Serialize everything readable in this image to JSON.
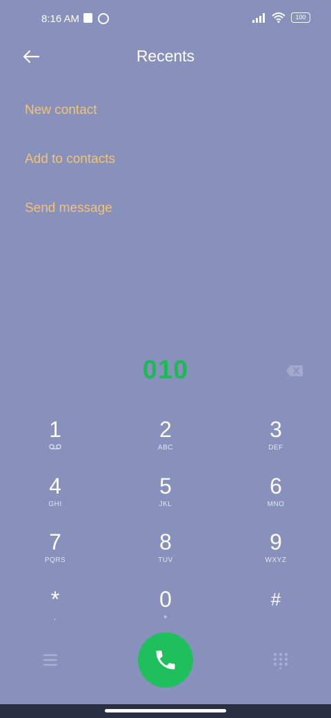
{
  "status_bar": {
    "time": "8:16 AM",
    "battery": "100",
    "icons": [
      "notification-square-icon",
      "app-ring-icon",
      "signal-icon",
      "wifi-icon",
      "battery-icon"
    ]
  },
  "header": {
    "title": "Recents",
    "back_icon": "arrow-left-icon"
  },
  "actions": [
    {
      "label": "New contact"
    },
    {
      "label": "Add to contacts"
    },
    {
      "label": "Send message"
    }
  ],
  "dialer": {
    "number": "010",
    "backspace_icon": "backspace-icon"
  },
  "keypad": [
    {
      "digit": "1",
      "sub": "",
      "sub_icon": "voicemail-icon"
    },
    {
      "digit": "2",
      "sub": "ABC"
    },
    {
      "digit": "3",
      "sub": "DEF"
    },
    {
      "digit": "4",
      "sub": "GHI"
    },
    {
      "digit": "5",
      "sub": "JKL"
    },
    {
      "digit": "6",
      "sub": "MNO"
    },
    {
      "digit": "7",
      "sub": "PQRS"
    },
    {
      "digit": "8",
      "sub": "TUV"
    },
    {
      "digit": "9",
      "sub": "WXYZ"
    },
    {
      "digit": "*",
      "sub": ","
    },
    {
      "digit": "0",
      "sub": "+"
    },
    {
      "digit": "#",
      "sub": ""
    }
  ],
  "bottom_bar": {
    "menu_icon": "hamburger-menu-icon",
    "call_icon": "phone-icon",
    "dialpad_icon": "dialpad-grid-icon"
  },
  "colors": {
    "background": "#8890bc",
    "accent_action": "#f3c46f",
    "number": "#1db954",
    "call_button": "#1fbf5b"
  }
}
